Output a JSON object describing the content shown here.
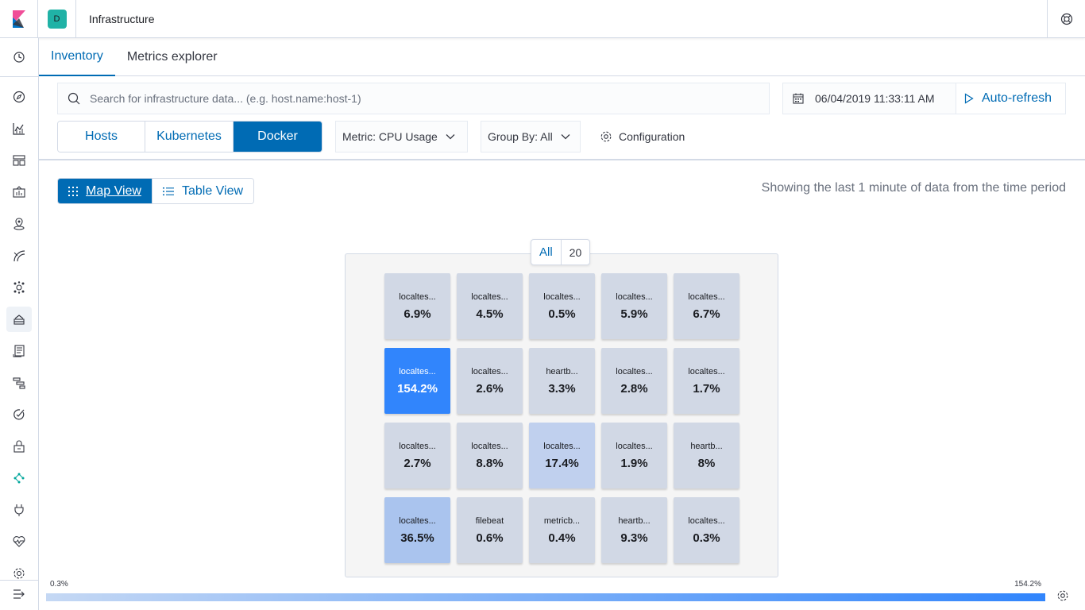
{
  "header": {
    "space_initial": "D",
    "app_title": "Infrastructure"
  },
  "nav": {
    "icons": [
      "clock-icon",
      "compass-icon",
      "visualize-icon",
      "dashboard-icon",
      "canvas-icon",
      "maps-icon",
      "ml-icon",
      "graph-icon",
      "infrastructure-icon",
      "logs-icon",
      "apm-icon",
      "uptime-icon",
      "siem-icon",
      "dev-tools-icon",
      "monitoring-icon",
      "heartbeat-icon",
      "management-icon",
      "collapse-icon"
    ]
  },
  "tabs": [
    {
      "label": "Inventory"
    },
    {
      "label": "Metrics explorer"
    }
  ],
  "search": {
    "placeholder": "Search for infrastructure data... (e.g. host.name:host-1)"
  },
  "datepicker": {
    "date": "06/04/2019 11:33:11 AM",
    "refresh_label": "Auto-refresh"
  },
  "node_types": [
    {
      "label": "Hosts"
    },
    {
      "label": "Kubernetes"
    },
    {
      "label": "Docker"
    }
  ],
  "metric_dropdown": "Metric: CPU Usage",
  "groupby_dropdown": "Group By: All",
  "config_label": "Configuration",
  "view_toggle": {
    "map": "Map View",
    "table": "Table View"
  },
  "showing_text": "Showing the last 1 minute of data from the time period",
  "group": {
    "name": "All",
    "count": "20"
  },
  "nodes": [
    {
      "name": "localtes...",
      "value": "6.9%",
      "color": "#d1d8e5"
    },
    {
      "name": "localtes...",
      "value": "4.5%",
      "color": "#d1d8e5"
    },
    {
      "name": "localtes...",
      "value": "0.5%",
      "color": "#d1d8e5"
    },
    {
      "name": "localtes...",
      "value": "5.9%",
      "color": "#d1d8e5"
    },
    {
      "name": "localtes...",
      "value": "6.7%",
      "color": "#d1d8e5"
    },
    {
      "name": "localtes...",
      "value": "154.2%",
      "color": "#3185fc"
    },
    {
      "name": "localtes...",
      "value": "2.6%",
      "color": "#d1d8e5"
    },
    {
      "name": "heartb...",
      "value": "3.3%",
      "color": "#d1d8e5"
    },
    {
      "name": "localtes...",
      "value": "2.8%",
      "color": "#d1d8e5"
    },
    {
      "name": "localtes...",
      "value": "1.7%",
      "color": "#d1d8e5"
    },
    {
      "name": "localtes...",
      "value": "2.7%",
      "color": "#d1d8e5"
    },
    {
      "name": "localtes...",
      "value": "8.8%",
      "color": "#d1d8e5"
    },
    {
      "name": "localtes...",
      "value": "17.4%",
      "color": "#c0d0ee"
    },
    {
      "name": "localtes...",
      "value": "1.9%",
      "color": "#d1d8e5"
    },
    {
      "name": "heartb...",
      "value": "8%",
      "color": "#d1d8e5"
    },
    {
      "name": "localtes...",
      "value": "36.5%",
      "color": "#aac4ee"
    },
    {
      "name": "filebeat",
      "value": "0.6%",
      "color": "#d1d8e5"
    },
    {
      "name": "metricb...",
      "value": "0.4%",
      "color": "#d1d8e5"
    },
    {
      "name": "heartb...",
      "value": "9.3%",
      "color": "#d1d8e5"
    },
    {
      "name": "localtes...",
      "value": "0.3%",
      "color": "#d1d8e5"
    }
  ],
  "legend": {
    "min": "0.3%",
    "max": "154.2%",
    "min_color": "#c5d8f4",
    "max_color": "#3185fc"
  }
}
